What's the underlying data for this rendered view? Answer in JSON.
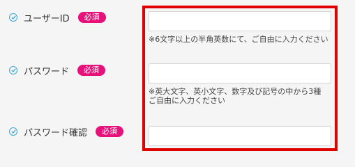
{
  "fields": [
    {
      "label": "ユーザーID",
      "badge": "必須",
      "value": "",
      "help": [
        "※6文字以上の半角英数にて、ご自由に入力ください"
      ]
    },
    {
      "label": "パスワード",
      "badge": "必須",
      "value": "",
      "help": [
        "※英大文字、英小文字、数字及び記号の中から3種",
        "ご自由に入力ください"
      ]
    },
    {
      "label": "パスワード確認",
      "badge": "必須",
      "value": "",
      "help": []
    }
  ],
  "icons": {
    "label_icon": "check-circle-icon"
  },
  "colors": {
    "badge_bg": "#e6117a",
    "icon": "#3aa6d8",
    "highlight": "#e00000"
  }
}
